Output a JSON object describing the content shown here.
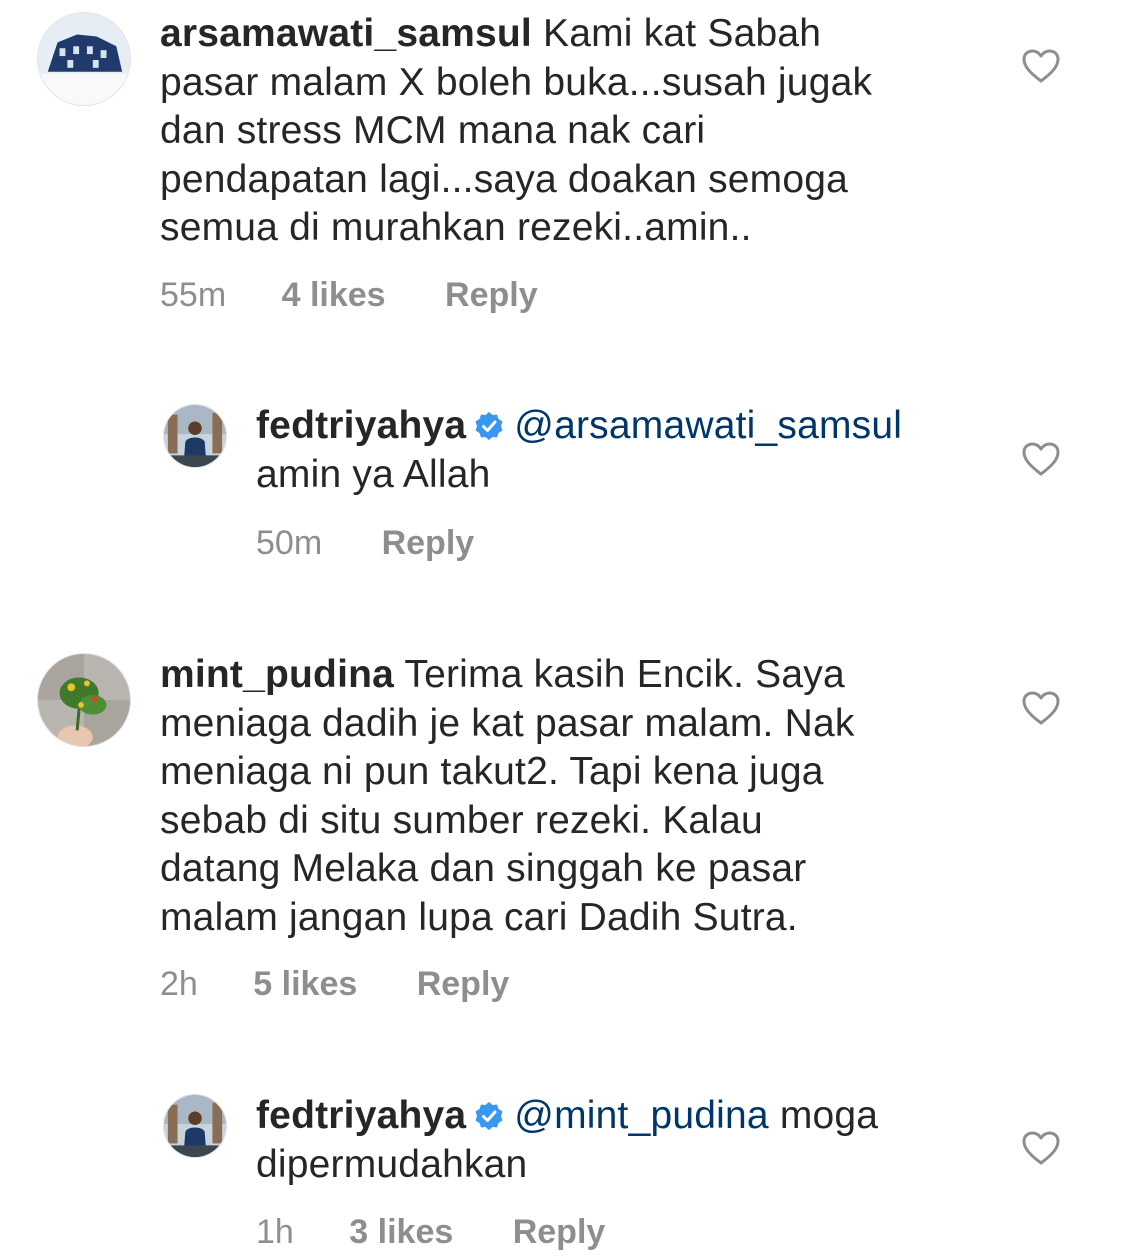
{
  "comments": [
    {
      "username": "arsamawati_samsul",
      "lines": [
        "Kami kat Sabah",
        "pasar malam X boleh buka...susah jugak",
        "dan stress MCM mana nak cari",
        "pendapatan lagi...saya doakan semoga",
        "semua di murahkan rezeki..amin.."
      ],
      "time": "55m",
      "likes": "4 likes",
      "reply": "Reply"
    },
    {
      "username": "fedtriyahya",
      "verified": true,
      "mention": "@arsamawati_samsul",
      "lines": [
        "",
        "amin ya Allah"
      ],
      "time": "50m",
      "reply": "Reply"
    },
    {
      "username": "mint_pudina",
      "lines": [
        "Terima kasih Encik. Saya",
        "meniaga dadih je kat pasar malam. Nak",
        "meniaga ni pun takut2. Tapi kena juga",
        "sebab di situ sumber rezeki. Kalau",
        "datang Melaka dan singgah ke pasar",
        "malam jangan lupa cari Dadih Sutra."
      ],
      "time": "2h",
      "likes": "5 likes",
      "reply": "Reply"
    },
    {
      "username": "fedtriyahya",
      "verified": true,
      "mention": "@mint_pudina",
      "lines": [
        "moga",
        "dipermudahkan"
      ],
      "time": "1h",
      "likes": "3 likes",
      "reply": "Reply"
    }
  ],
  "colors": {
    "text": "#262626",
    "secondary": "#8e8e8e",
    "mention": "#00376b",
    "verified": "#3897f0"
  },
  "icons": {
    "like": "heart-outline-icon",
    "verified": "verified-badge-icon"
  }
}
